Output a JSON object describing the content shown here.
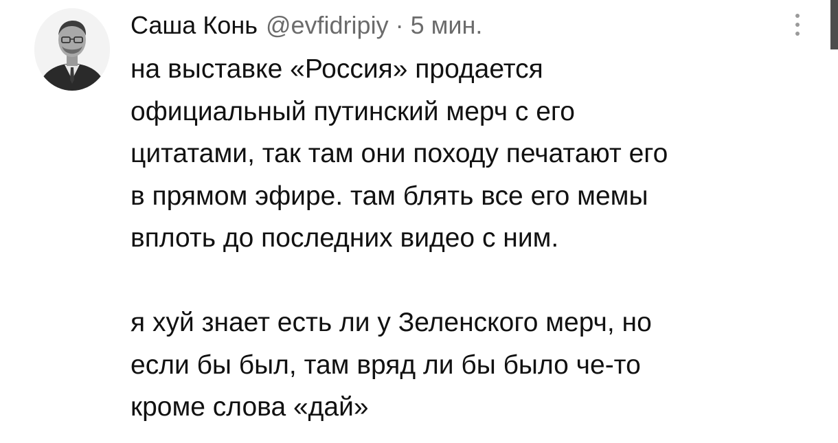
{
  "tweet": {
    "author": {
      "display_name": "Саша Конь",
      "handle": "@evfidripiy",
      "separator": "·",
      "time": "5 мин."
    },
    "avatar_icon": "avatar-photo",
    "menu_icon": "more-vertical-icon",
    "paragraphs": [
      {
        "lines": [
          "на выставке «Россия» продается",
          "официальный путинский мерч с его",
          "цитатами, так там они походу печатают его",
          "в прямом эфире. там блять все его мемы",
          "вплоть до последних видео с ним."
        ]
      },
      {
        "lines": [
          "я хуй знает есть ли у Зеленского мерч, но",
          "если бы был, там вряд ли бы было че-то",
          "кроме слова «дай»"
        ]
      }
    ]
  }
}
